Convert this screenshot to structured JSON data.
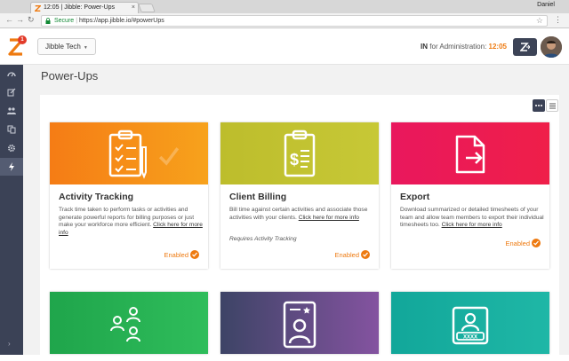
{
  "browser": {
    "tab_title": "12:05 | Jibble: Power-Ups",
    "user": "Daniel",
    "secure_label": "Secure",
    "url": "https://app.jibble.io/#powerUps"
  },
  "header": {
    "logo_badge": "1",
    "org_name": "Jibble Tech",
    "status_in": "IN",
    "status_for": "for Administration:",
    "status_time": "12:05"
  },
  "page": {
    "title": "Power-Ups"
  },
  "cards": [
    {
      "title": "Activity Tracking",
      "description": "Track time taken to perform tasks or activities and generate powerful reports for billing purposes or just make your workforce more efficient.",
      "link": "Click here for more info",
      "enabled_label": "Enabled"
    },
    {
      "title": "Client Billing",
      "description": "Bill time against certain activities and associate those activities with your clients.",
      "link": "Click here for more info",
      "requires": "Requires Activity Tracking",
      "enabled_label": "Enabled"
    },
    {
      "title": "Export",
      "description": "Download summarized or detailed timesheets of your team and allow team members to export their individual timesheets too.",
      "link": "Click here for more info",
      "enabled_label": "Enabled"
    },
    {
      "card_id_word": "",
      "id_text": "XXXX"
    }
  ],
  "colors": {
    "accent_orange": "#ee7a10",
    "sidebar": "#3b4256",
    "activity_banner": "#f57c15",
    "billing_banner": "#bdbd2c",
    "export_banner": "#e9175d",
    "team_banner": "#1fa54b",
    "profile_banner": "#5b4a82",
    "id_banner": "#12a79a"
  }
}
